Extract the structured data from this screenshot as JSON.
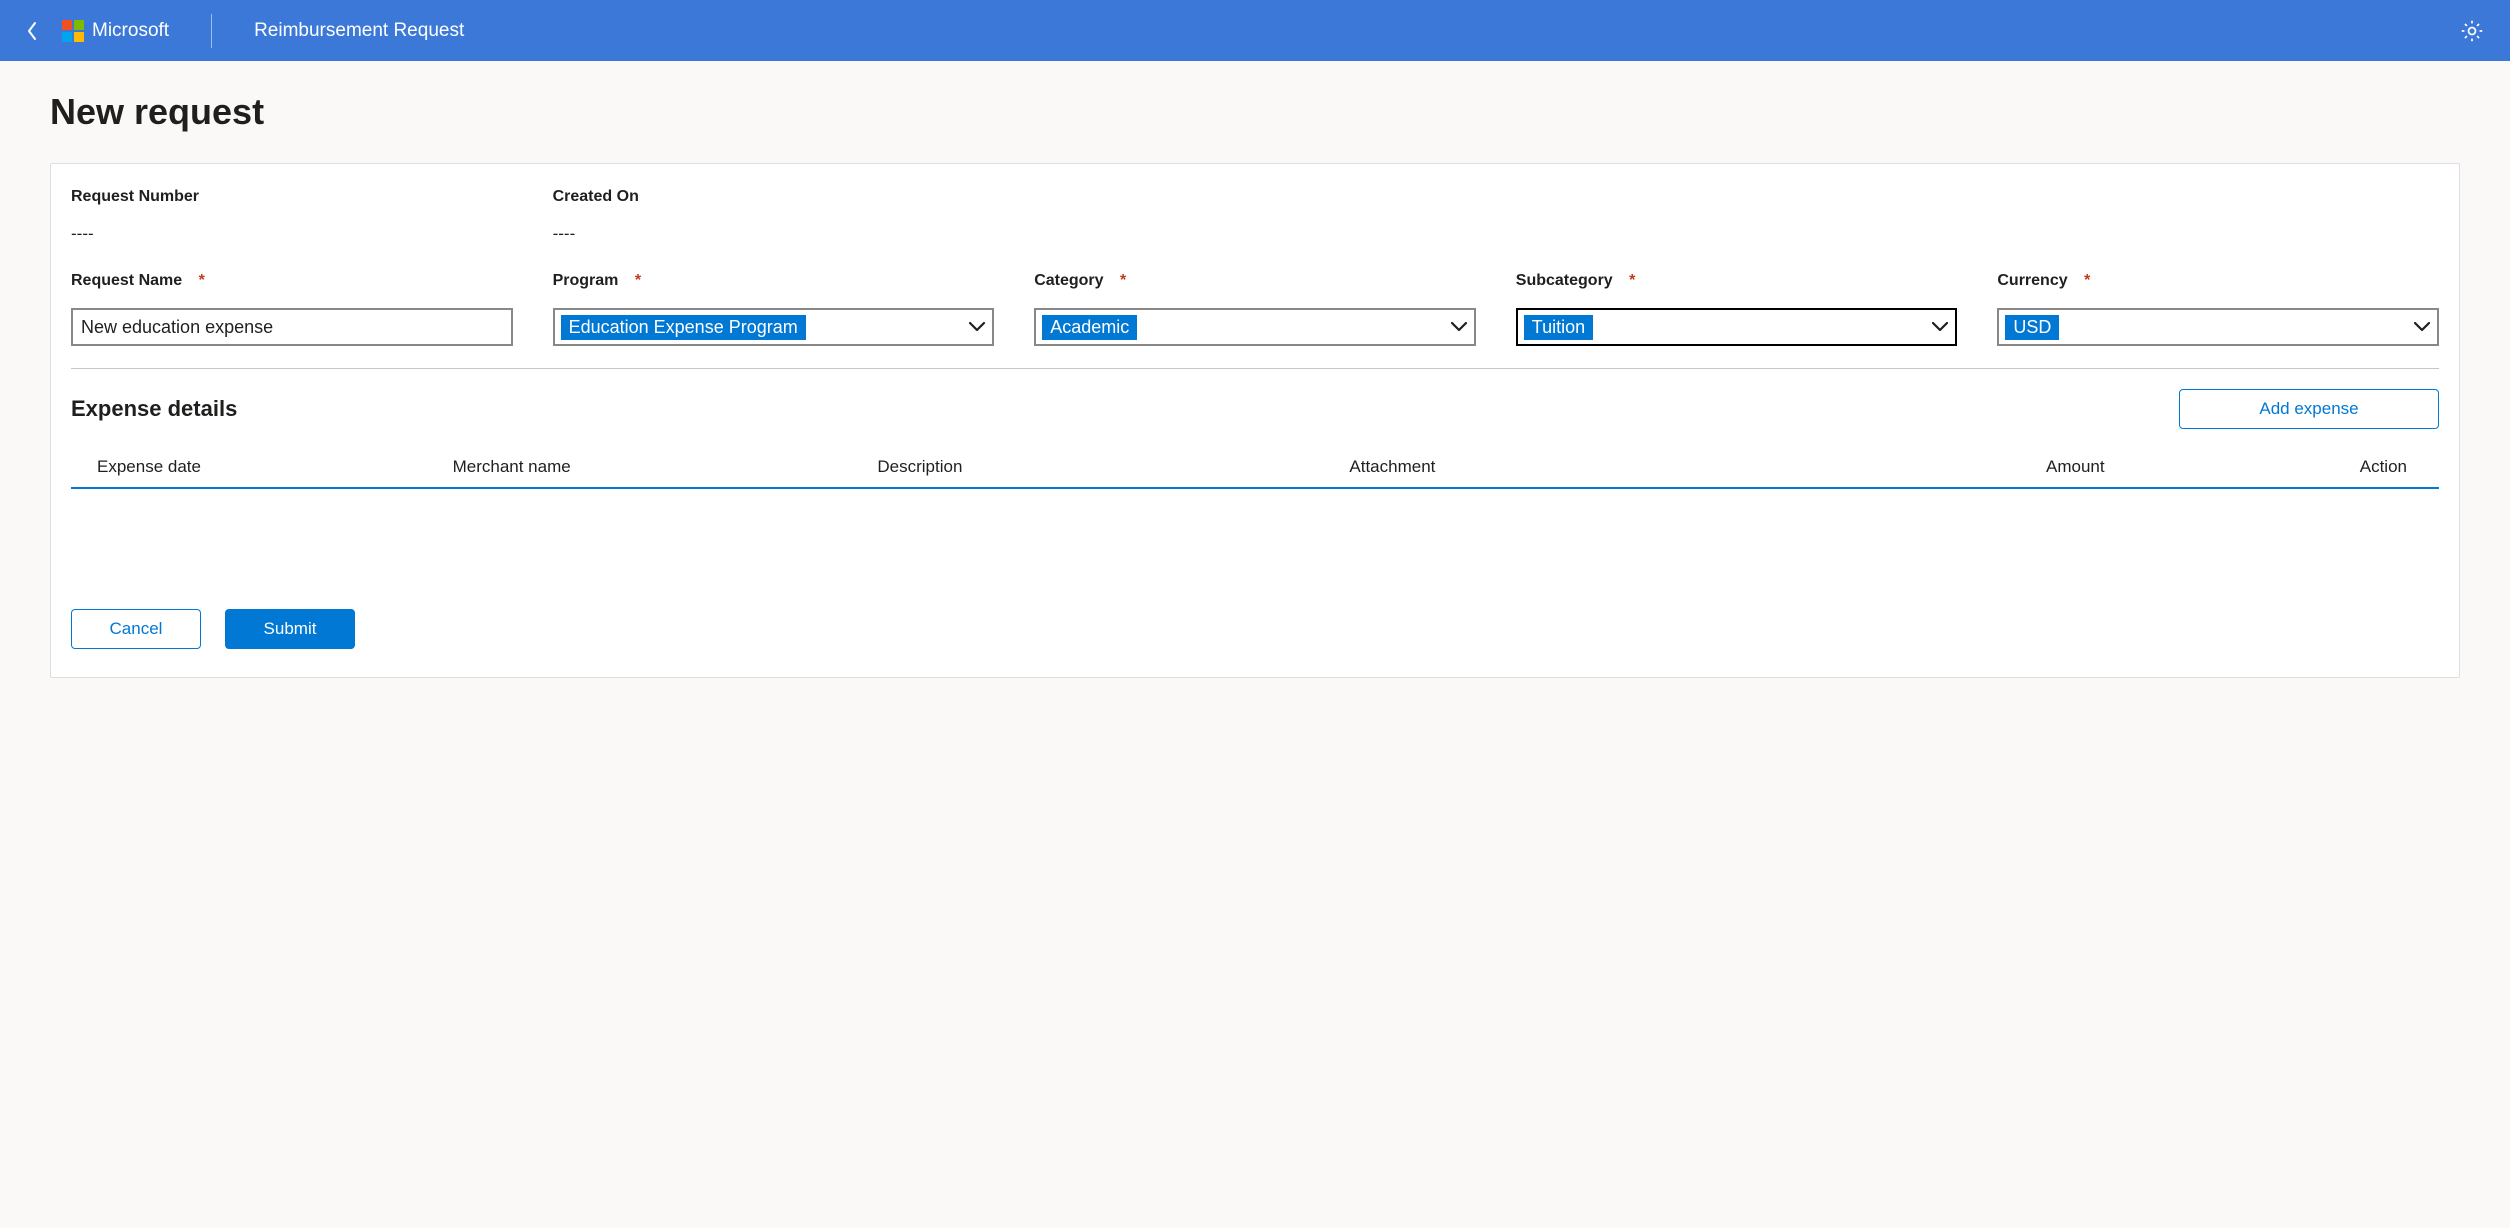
{
  "header": {
    "brand": "Microsoft",
    "app_title": "Reimbursement Request"
  },
  "page": {
    "title": "New request"
  },
  "fields": {
    "request_number": {
      "label": "Request Number",
      "value": "----"
    },
    "created_on": {
      "label": "Created On",
      "value": "----"
    },
    "request_name": {
      "label": "Request Name",
      "value": "New education expense"
    },
    "program": {
      "label": "Program",
      "value": "Education Expense Program"
    },
    "category": {
      "label": "Category",
      "value": "Academic"
    },
    "subcategory": {
      "label": "Subcategory",
      "value": "Tuition"
    },
    "currency": {
      "label": "Currency",
      "value": "USD"
    }
  },
  "details": {
    "title": "Expense details",
    "add_label": "Add expense",
    "columns": {
      "date": "Expense date",
      "merchant": "Merchant name",
      "description": "Description",
      "attachment": "Attachment",
      "amount": "Amount",
      "action": "Action"
    }
  },
  "buttons": {
    "cancel": "Cancel",
    "submit": "Submit"
  }
}
